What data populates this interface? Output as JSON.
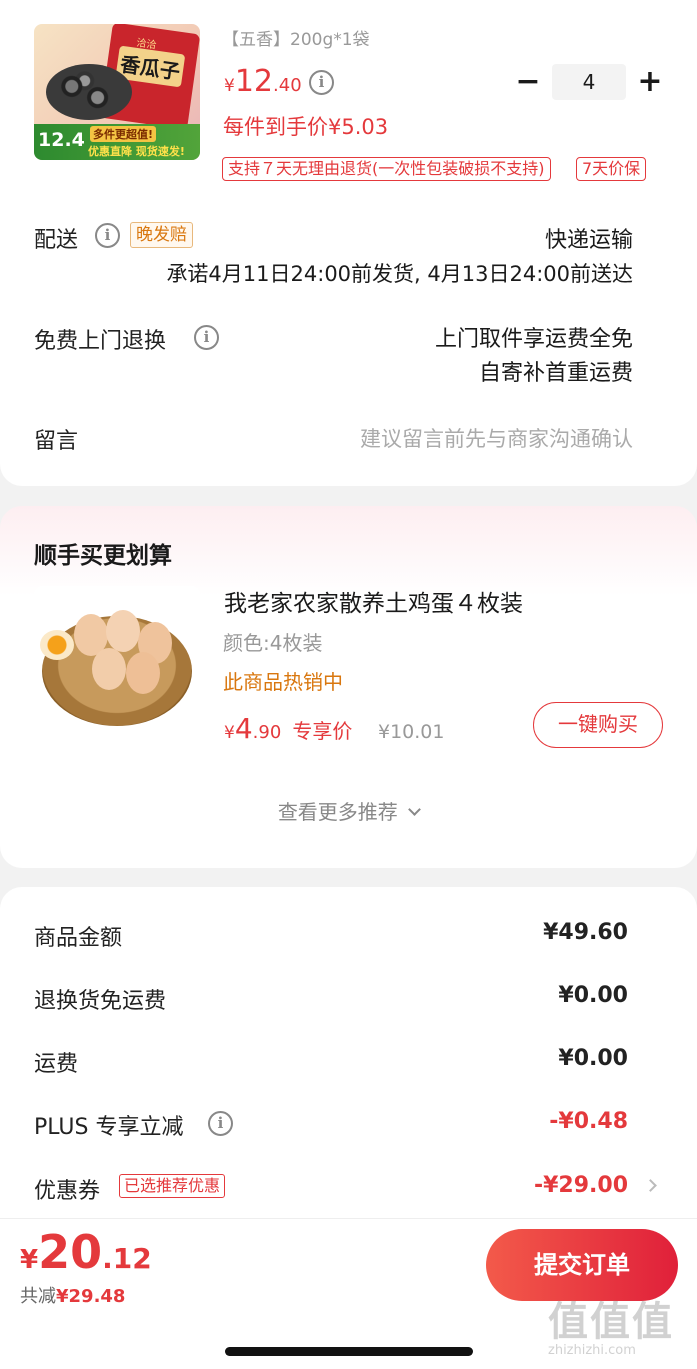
{
  "product": {
    "image": {
      "brand_text": "洽洽",
      "name_text": "香瓜子",
      "badge_price": "12.4",
      "badge_line1": "多件更超值!",
      "badge_line2": "优惠直降 现货速发!"
    },
    "spec": "【五香】200g*1袋",
    "price_symbol": "¥",
    "price_int": "12",
    "price_dec": ".40",
    "unit_price": "每件到手价¥5.03",
    "quantity": "4",
    "minus": "−",
    "plus": "+",
    "return_tag": "支持７天无理由退货(一次性包装破损不支持)",
    "price_protect_tag": "7天价保"
  },
  "delivery": {
    "label": "配送",
    "late_tag": "晚发赔",
    "method": "快递运输",
    "promise": "承诺4月11日24:00前发货, 4月13日24:00前送达"
  },
  "return_service": {
    "label": "免费上门退换",
    "line1": "上门取件享运费全免",
    "line2": "自寄补首重运费"
  },
  "message": {
    "label": "留言",
    "placeholder": "建议留言前先与商家沟通确认"
  },
  "addon": {
    "title": "顺手买更划算",
    "product_name": "我老家农家散养土鸡蛋４枚装",
    "spec": "颜色:4枚装",
    "hot": "此商品热销中",
    "price_symbol": "¥",
    "price_int": "4",
    "price_dec": ".90",
    "exclusive_label": "专享价",
    "original_price": "¥10.01",
    "buy_button": "一键购买",
    "more": "查看更多推荐"
  },
  "summary": {
    "rows": [
      {
        "label": "商品金额",
        "value": "¥49.60"
      },
      {
        "label": "退换货免运费",
        "value": "¥0.00"
      },
      {
        "label": "运费",
        "value": "¥0.00"
      },
      {
        "label": "PLUS 专享立减",
        "value": "-¥0.48"
      },
      {
        "label": "优惠券",
        "value": "-¥29.00"
      }
    ],
    "coupon_tag": "已选推荐优惠"
  },
  "footer": {
    "total_symbol": "¥",
    "total_int": "20",
    "total_dec": ".12",
    "saved_label": "共减",
    "saved_value": "¥29.48",
    "submit": "提交订单"
  },
  "watermark": {
    "text": "值值值",
    "url": "zhizhizhi.com"
  },
  "colors": {
    "accent": "#e4393c",
    "orange": "#d9770f",
    "submit_gradient": [
      "#f35a4a",
      "#e0203a"
    ]
  }
}
